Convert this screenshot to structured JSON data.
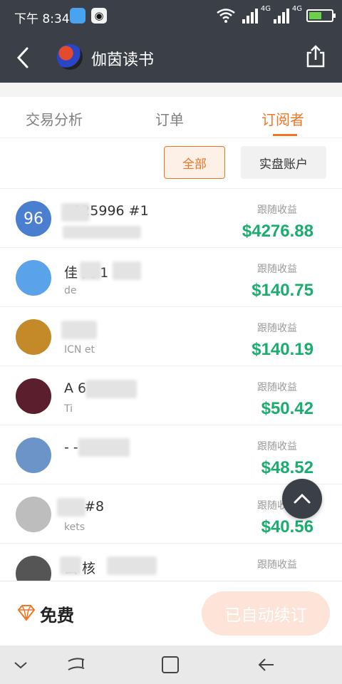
{
  "status": {
    "time": "下午 8:34",
    "battery_level": 0.55,
    "net1": "4G",
    "net2": "4G"
  },
  "header": {
    "title": "伽茵读书"
  },
  "tabs": [
    {
      "label": "交易分析"
    },
    {
      "label": "订单"
    },
    {
      "label": "订阅者",
      "active": true
    }
  ],
  "filter": {
    "all_label": "全部",
    "real_label": "实盘账户"
  },
  "subscribers": [
    {
      "avatar_text": "96",
      "avatar_color": "#4a7fd0",
      "name": "1225996 #1",
      "sub": "",
      "label": "跟随收益",
      "amount": "$4276.88"
    },
    {
      "avatar_text": "",
      "avatar_color": "#5aa2ea",
      "name": "佳  爽   1",
      "sub": "de",
      "label": "跟随收益",
      "amount": "$140.75"
    },
    {
      "avatar_text": "",
      "avatar_color": "#c48a2a",
      "name": "#",
      "sub": "ICN  et",
      "label": "跟随收益",
      "amount": "$140.19"
    },
    {
      "avatar_text": "",
      "avatar_color": "#5a1e2c",
      "name": "A      6",
      "sub": "Ti",
      "label": "跟随收益",
      "amount": "$50.42"
    },
    {
      "avatar_text": "",
      "avatar_color": "#6d94c8",
      "name": "-   -   #2",
      "sub": "",
      "label": "跟随收益",
      "amount": "$48.52"
    },
    {
      "avatar_text": "",
      "avatar_color": "#bdbdbd",
      "name": "  ca #8",
      "sub": "  kets",
      "label": "跟随收益",
      "amount": "$40.56"
    },
    {
      "avatar_text": "",
      "avatar_color": "#555555",
      "name": "  云 核",
      "sub": "",
      "label": "跟随收益",
      "amount": ""
    }
  ],
  "bottom": {
    "plan_label": "免费",
    "subscribe_label": "已自动续订"
  },
  "colors": {
    "accent": "#f07524",
    "profit": "#1aad6e",
    "header_bg": "#3b4048"
  }
}
